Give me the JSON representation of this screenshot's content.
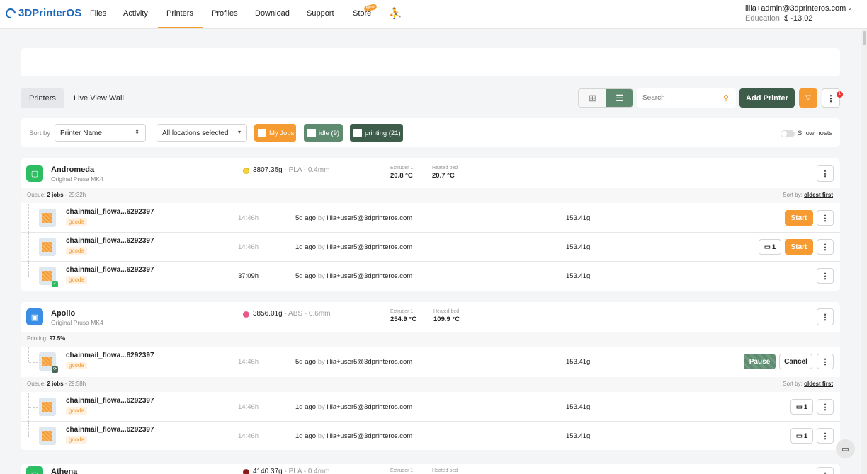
{
  "nav": {
    "logo": "3DPrinterOS",
    "items": [
      "Files",
      "Activity",
      "Printers",
      "Profiles",
      "Download",
      "Support",
      "Store"
    ],
    "store_badge": "New",
    "account_email": "illia+admin@3dprinteros.com",
    "account_plan": "Education",
    "account_balance": "$ -13.02"
  },
  "tabs": [
    "Printers",
    "Live View Wall"
  ],
  "toolbar": {
    "search_placeholder": "Search",
    "add_printer": "Add Printer",
    "notification_count": "1"
  },
  "filters": {
    "sort_label": "Sort by",
    "sort_value": "Printer Name",
    "location_value": "All locations selected",
    "chips": [
      "My Jobs",
      "idle (9)",
      "printing (21)"
    ],
    "show_hosts": "Show hosts"
  },
  "printers": [
    {
      "name": "Andromeda",
      "model": "Original Prusa MK4",
      "filament_amount": "3807.35g",
      "filament_spec": " - PLA - 0.4mm",
      "extruder_label": "Extruder 1",
      "extruder_temp": "20.8 °C",
      "bed_label": "Heated bed",
      "bed_temp": "20.7 °C",
      "queue_prefix": "Queue:",
      "queue_count": "2 jobs",
      "queue_time": " - 29:32h",
      "sort_prefix": "Sort by:",
      "sort_value": "oldest first",
      "jobs": [
        {
          "name": "chainmail_flowa...6292397",
          "tag": "gcode",
          "duration": "14:46h",
          "ago": "5d ago",
          "by": " by ",
          "user": "illia+user5@3dprinteros.com",
          "weight": "153.41g",
          "action": "Start"
        },
        {
          "name": "chainmail_flowa...6292397",
          "tag": "gcode",
          "duration": "14:46h",
          "ago": "1d ago",
          "by": " by ",
          "user": "illia+user5@3dprinteros.com",
          "weight": "153.41g",
          "action": "Start",
          "comments": "1"
        },
        {
          "name": "chainmail_flowa...6292397",
          "tag": "gcode",
          "duration": "37:09h",
          "ago": "5d ago",
          "by": " by ",
          "user": "illia+user5@3dprinteros.com",
          "weight": "153.41g"
        }
      ]
    },
    {
      "name": "Apollo",
      "model": "Original Prusa MK4",
      "filament_amount": "3856.01g",
      "filament_spec": " - ABS - 0.6mm",
      "extruder_label": "Extruder 1",
      "extruder_temp": "254.9 °C",
      "bed_label": "Heated bed",
      "bed_temp": "109.9 °C",
      "printing_prefix": "Printing:",
      "printing_progress": "97.5%",
      "current_job": {
        "name": "chainmail_flowa...6292397",
        "tag": "gcode",
        "duration": "14:46h",
        "ago": "5d ago",
        "by": " by ",
        "user": "illia+user5@3dprinteros.com",
        "weight": "153.41g",
        "pause": "Pause",
        "cancel": "Cancel"
      },
      "queue_prefix": "Queue:",
      "queue_count": "2 jobs",
      "queue_time": " - 29:58h",
      "sort_prefix": "Sort by:",
      "sort_value": "oldest first",
      "jobs": [
        {
          "name": "chainmail_flowa...6292397",
          "tag": "gcode",
          "duration": "14:46h",
          "ago": "1d ago",
          "by": " by ",
          "user": "illia+user5@3dprinteros.com",
          "weight": "153.41g",
          "comments": "1"
        },
        {
          "name": "chainmail_flowa...6292397",
          "tag": "gcode",
          "duration": "14:46h",
          "ago": "1d ago",
          "by": " by ",
          "user": "illia+user5@3dprinteros.com",
          "weight": "153.41g",
          "comments": "1"
        }
      ]
    },
    {
      "name": "Athena",
      "filament_amount": "4140.37g",
      "filament_spec": " - PLA - 0.4mm",
      "extruder_label": "Extruder 1",
      "bed_label": "Heated bed"
    }
  ],
  "colors": {
    "accent": "#f59b32",
    "green": "#5e8b6f",
    "dark_green": "#3e5c4a",
    "andromeda_icon": "#2dbd63",
    "apollo_icon": "#3a8ee6",
    "pla_dot": "#f5d33a",
    "abs_dot": "#e8588a",
    "athena_dot": "#8b1a1a"
  },
  "icons": [
    "logo-icon",
    "run-icon",
    "chevron-down-icon",
    "grid-view-icon",
    "list-view-icon",
    "search-icon",
    "filter-icon",
    "kebab-icon",
    "printer-icon",
    "comment-icon",
    "chat-icon"
  ]
}
